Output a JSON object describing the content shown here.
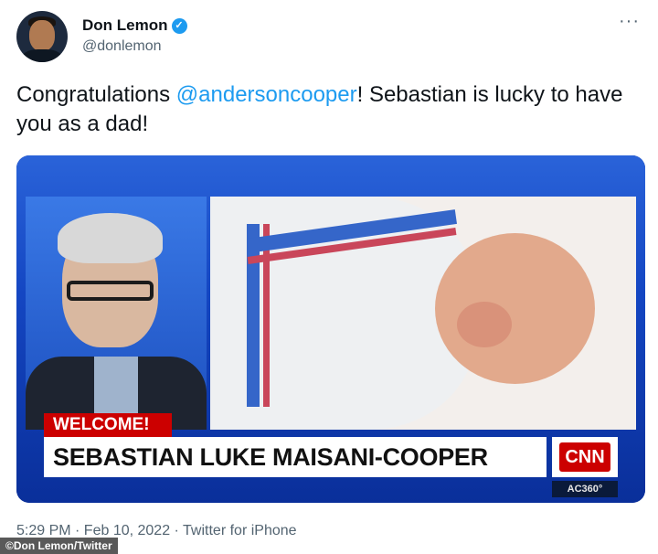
{
  "tweet": {
    "author_name": "Don Lemon",
    "handle": "@donlemon",
    "more_label": "···",
    "text_before": "Congratulations ",
    "mention": "@andersoncooper",
    "text_after": "! Sebastian is lucky to have you as a dad!",
    "meta": "5:29 PM · Feb 10, 2022 · Twitter for iPhone"
  },
  "media": {
    "welcome_label": "WELCOME!",
    "chyron": "SEBASTIAN LUKE MAISANI-COOPER",
    "network_logo": "CNN",
    "show_tag": "AC360°"
  },
  "image_credit": "©Don Lemon/Twitter",
  "colors": {
    "accent": "#1d9bf0",
    "cnn_red": "#cc0000",
    "muted_text": "#536471"
  },
  "icons": {
    "verified": "verified-badge-icon",
    "more": "more-options-icon"
  }
}
